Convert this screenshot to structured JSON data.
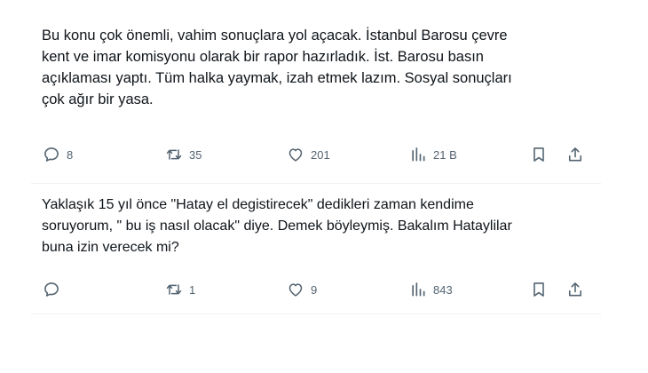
{
  "tweets": [
    {
      "text": "Bu konu çok önemli, vahim sonuçlara  yol açacak. İstanbul Barosu çevre\nkent ve imar komisyonu olarak bir rapor hazırladık. İst. Barosu basın\naçıklaması yaptı. Tüm halka yaymak, izah etmek lazım. Sosyal sonuçları\nçok ağır bir yasa.",
      "replies": "8",
      "retweets": "35",
      "likes": "201",
      "views": "21 B"
    },
    {
      "text": "Yaklaşık 15 yıl önce \"Hatay el degistirecek\" dedikleri zaman kendime\nsoruyorum, \" bu iş nasıl olacak\" diye. Demek böyleymiş. Bakalım Hataylilar\nbuna izin verecek mi?",
      "replies": "",
      "retweets": "1",
      "likes": "9",
      "views": "843"
    }
  ],
  "icons": {
    "reply": "reply-icon",
    "retweet": "retweet-icon",
    "like": "like-icon",
    "views": "views-icon",
    "bookmark": "bookmark-icon",
    "share": "share-icon"
  },
  "colors": {
    "text": "#0f1419",
    "secondary": "#536471",
    "divider": "#eff3f4"
  }
}
